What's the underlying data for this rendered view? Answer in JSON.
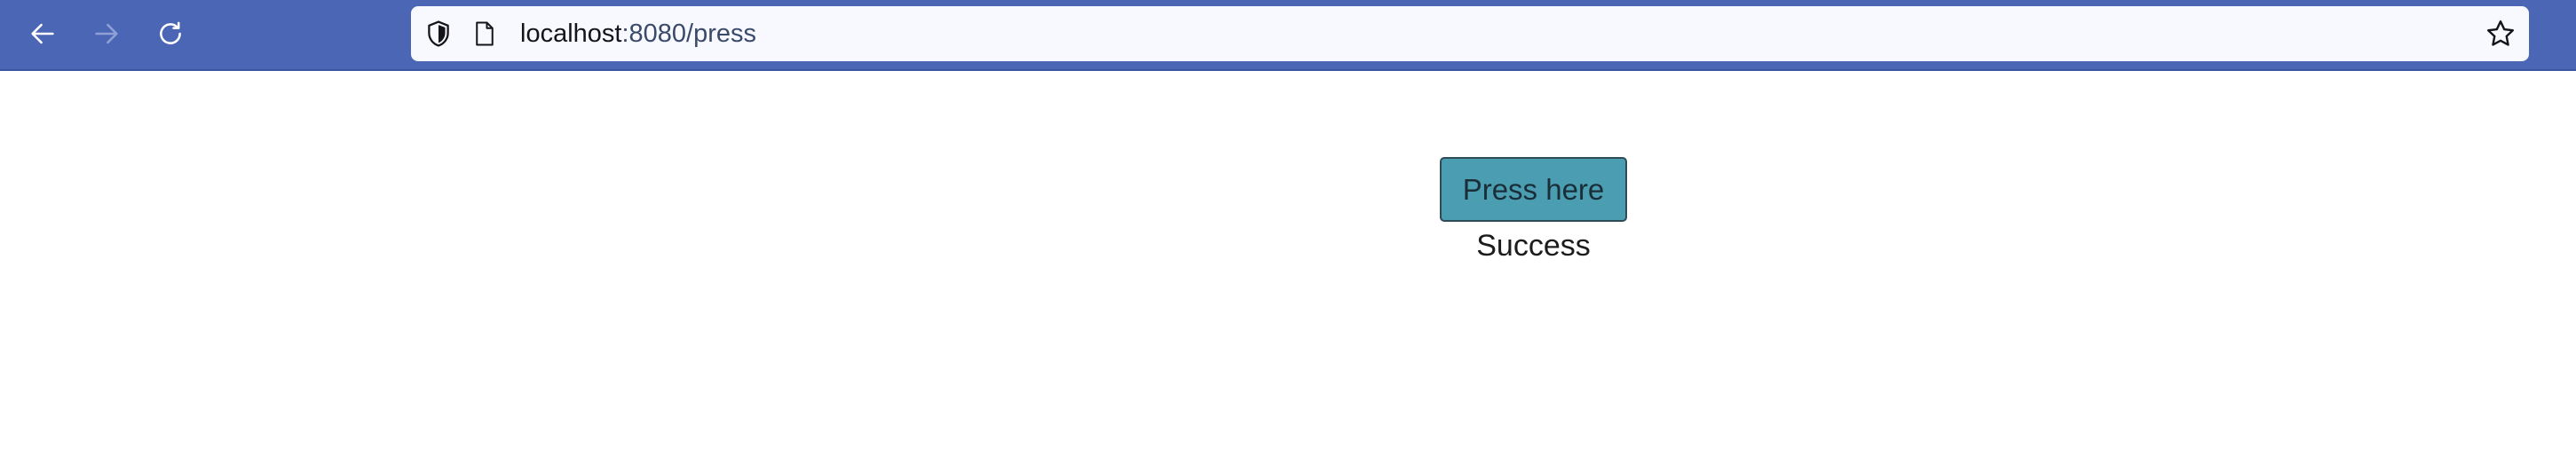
{
  "browser": {
    "url_host": "localhost",
    "url_rest": ":8080/press",
    "toolbar_color": "#4a66b5",
    "icons": [
      "back-arrow-icon",
      "forward-arrow-icon",
      "reload-icon",
      "shield-icon",
      "page-icon",
      "star-icon"
    ]
  },
  "page": {
    "button_label": "Press here",
    "button_color": "#4b9db1",
    "status_text": "Success"
  }
}
